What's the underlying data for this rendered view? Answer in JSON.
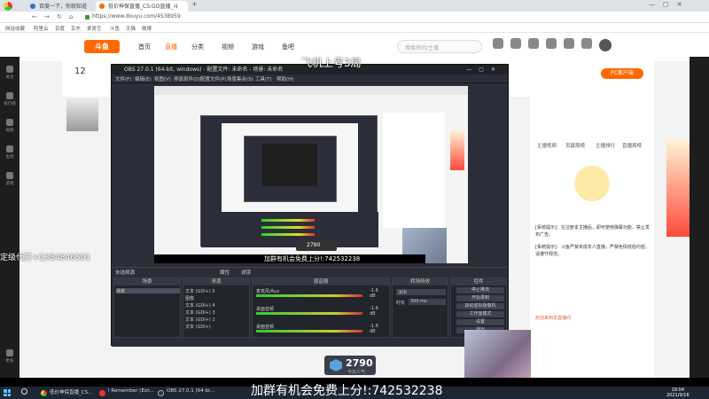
{
  "browser": {
    "tabs": [
      {
        "label": "百度一下，你就知道",
        "active": false
      },
      {
        "label": "低价神保直播_CS:GO直播_斗",
        "active": true
      }
    ],
    "url": "https://www.douyu.com/4538959",
    "bookmarks": [
      "网址收藏",
      "阿里云",
      "百度",
      "京东",
      "爱奇艺",
      "斗鱼",
      "天猫",
      "微博"
    ]
  },
  "site": {
    "logo": "斗鱼",
    "nav": [
      "首页",
      "直播",
      "分类",
      "视频",
      "游戏",
      "鱼吧"
    ],
    "search_placeholder": "搜索房间/主播",
    "pc_button": "PC客户端",
    "room_number": "12",
    "chat_tabs": [
      "主播视频",
      "贡献周榜",
      "主播排行",
      "直播周榜"
    ],
    "left_menu": [
      "关注",
      "排行榜",
      "视频",
      "鱼吧",
      "游戏",
      "更多"
    ],
    "chat_messages": [
      "[系统提示]：在注册本主播后，即可使用弹幕功能，禁止发布广告。",
      "[系统提示]：斗鱼严禁未成年人直播，严禁色情低俗内容，请遵守规范。",
      "欢迎来到本直播间"
    ]
  },
  "obs": {
    "title": "OBS 27.0.1 (64-bit, windows) - 配置文件: 未命名 - 场景: 未命名",
    "menu": [
      "文件(F)",
      "编辑(E)",
      "视图(V)",
      "停靠部件(D)",
      "配置文件(P)",
      "场景集合(S)",
      "工具(T)",
      "帮助(H)"
    ],
    "status_label": "未选择源",
    "docks": {
      "scenes": "场景",
      "sources": "来源",
      "mixer": "混音器",
      "transitions": "转场特效",
      "controls": "控件"
    },
    "scene_item": "场景",
    "sources": [
      "文本 (GDI+) 5",
      "图像",
      "文本 (GDI+) 4",
      "文本 (GDI+) 3",
      "文本 (GDI+) 2",
      "文本 (GDI+)"
    ],
    "mixer": [
      {
        "label": "麦克风/Aux",
        "db": "-1.6 dB"
      },
      {
        "label": "桌面音频",
        "db": "-1.6 dB"
      },
      {
        "label": "桌面音频",
        "db": "-1.6 dB"
      }
    ],
    "transition": {
      "type": "淡出",
      "duration_label": "时长",
      "duration": "300 ms"
    },
    "controls": [
      "停止推流",
      "开始录制",
      "启动虚拟摄像机",
      "工作室模式",
      "设置",
      "退出"
    ],
    "props_btn": "属性",
    "filter_btn": "滤镜"
  },
  "overlays": {
    "title": "飞机上号3局",
    "qq": "定级代打+Q384846501",
    "counter_value": "2790",
    "counter_sub": "今日人气",
    "banner": "加群有机会免费上分!:742532238"
  },
  "taskbar": {
    "search_icon": "search-icon",
    "items": [
      "低价神保直播_CS...",
      "I Remember (Ext...",
      "OBS 27.0.1 (64-bi..."
    ],
    "time": "19:04",
    "date": "2021/9/16"
  }
}
